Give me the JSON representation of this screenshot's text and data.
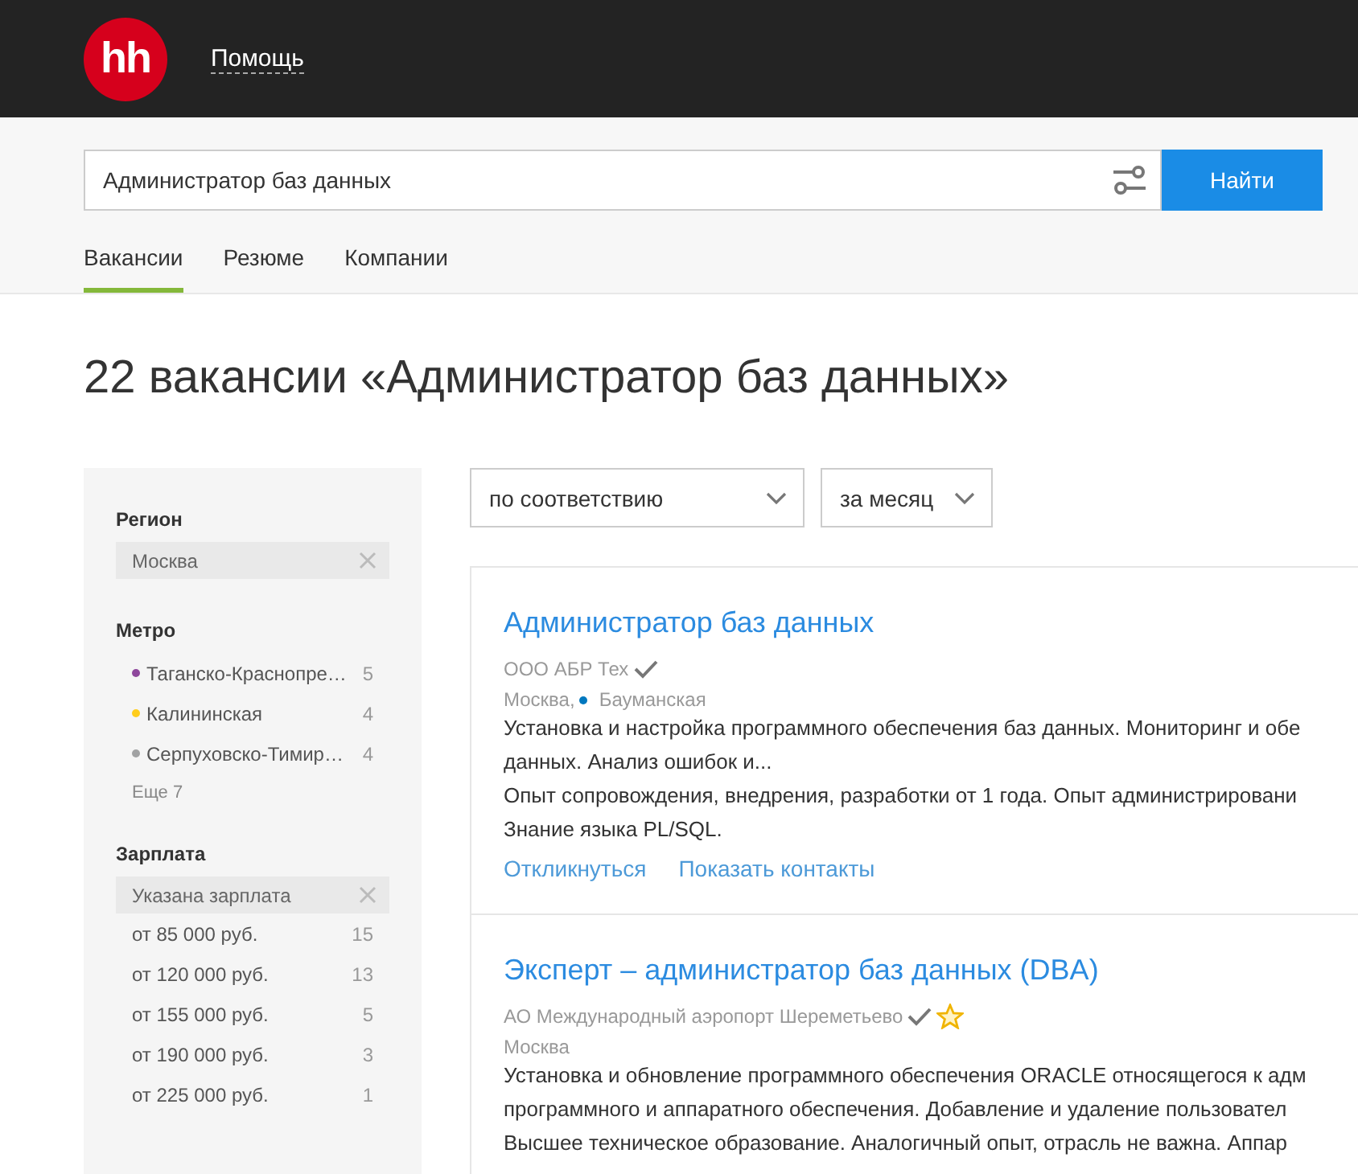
{
  "header": {
    "logo": "hh",
    "help_link": "Помощь"
  },
  "search": {
    "value": "Администратор баз данных",
    "button": "Найти"
  },
  "tabs": [
    {
      "label": "Вакансии",
      "selected": true
    },
    {
      "label": "Резюме",
      "selected": false
    },
    {
      "label": "Компании",
      "selected": false
    }
  ],
  "heading": "22 вакансии «Администратор баз данных»",
  "sidebar": {
    "groups": [
      {
        "title": "Регион",
        "chips": [
          "Москва"
        ]
      },
      {
        "title": "Метро",
        "items": [
          {
            "label": "Таганско-Краснопре…",
            "count": "5",
            "color": "#8e479c"
          },
          {
            "label": "Калининская",
            "count": "4",
            "color": "#ffcd1c"
          },
          {
            "label": "Серпуховско-Тимир…",
            "count": "4",
            "color": "#a1a2a3"
          }
        ],
        "more": "Еще 7"
      },
      {
        "title": "Зарплата",
        "chips": [
          "Указана зарплата"
        ],
        "items": [
          {
            "label": "от 85 000 руб.",
            "count": "15"
          },
          {
            "label": "от 120 000 руб.",
            "count": "13"
          },
          {
            "label": "от 155 000 руб.",
            "count": "5"
          },
          {
            "label": "от 190 000 руб.",
            "count": "3"
          },
          {
            "label": "от 225 000 руб.",
            "count": "1"
          }
        ]
      }
    ]
  },
  "sort": [
    {
      "value": "по соответствию"
    },
    {
      "value": "за месяц"
    }
  ],
  "vacancies": [
    {
      "title": "Администратор баз данных",
      "company": "ООО АБР Тех",
      "verified": true,
      "starred": false,
      "city": "Москва,",
      "metro": {
        "name": "Бауманская",
        "color": "#0078bf"
      },
      "lines": [
        "Установка и настройка программного обеспечения баз данных. Мониторинг и обе",
        "данных. Анализ ошибок и...",
        "Опыт сопровождения, внедрения, разработки от 1 года. Опыт администрировани",
        "Знание языка PL/SQL."
      ],
      "actions": [
        "Откликнуться",
        "Показать контакты"
      ]
    },
    {
      "title": "Эксперт – администратор баз данных (DBA)",
      "company": "АО Международный аэропорт Шереметьево",
      "verified": true,
      "starred": true,
      "city": "Москва",
      "lines": [
        "Установка и обновление программного обеспечения ORACLE относящегося к адм",
        "программного и аппаратного обеспечения. Добавление и удаление пользовател",
        "Высшее техническое образование. Аналогичный опыт, отрасль не важна. Аппар"
      ]
    }
  ]
}
